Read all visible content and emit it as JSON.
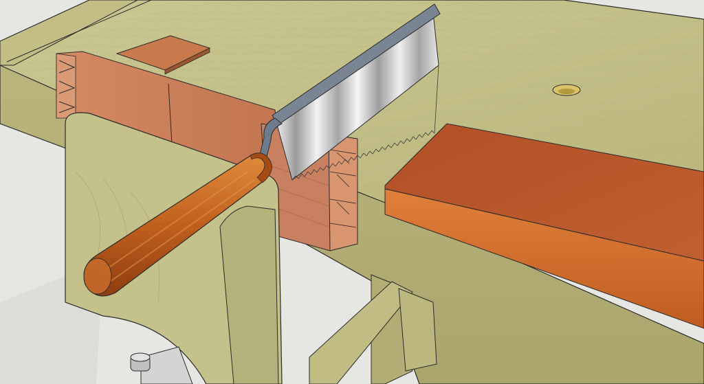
{
  "scene": {
    "subject": "woodworking-bench-with-dovetail-saw",
    "colors": {
      "floor": "#e3e3df",
      "bench_top": "#c9c48f",
      "bench_top_dark": "#a8a56e",
      "bench_edge": "#b6b27c",
      "wood_board": "#c9805a",
      "wood_board_dark": "#a8603f",
      "plank_top": "#b8572d",
      "plank_side": "#d06a2c",
      "saw_blade": "#c8c8c8",
      "saw_spine": "#6f7a88",
      "handle": "#c8641f",
      "handle_dark": "#8a3a12",
      "hole": "#d8c068",
      "metal": "#cfcfcf",
      "outline": "#2a2a2a"
    },
    "objects": [
      "workbench",
      "vise-chop",
      "dovetail-board-tails",
      "dovetail-board-pins",
      "dovetail-saw",
      "saw-handle",
      "planing-stop",
      "dog-hole",
      "mahogany-plank",
      "leg-stretcher",
      "vise-screw"
    ]
  }
}
